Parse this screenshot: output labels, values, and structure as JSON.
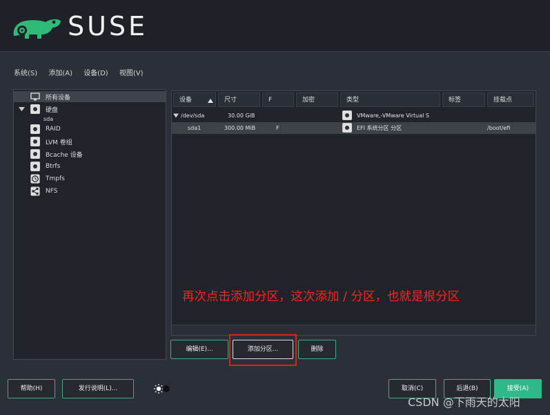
{
  "header": {
    "logo_text": "SUSE"
  },
  "menubar": [
    "系统(S)",
    "添加(A)",
    "设备(D)",
    "视图(V)"
  ],
  "tree": {
    "items": [
      {
        "label": "所有设备",
        "icon": "monitor-icon"
      },
      {
        "label": "硬盘",
        "icon": "harddisk-icon"
      },
      {
        "label": "sda",
        "icon": ""
      },
      {
        "label": "RAID",
        "icon": "raid-icon"
      },
      {
        "label": "LVM 卷组",
        "icon": "lvm-icon"
      },
      {
        "label": "Bcache 设备",
        "icon": "bcache-icon"
      },
      {
        "label": "Btrfs",
        "icon": "btrfs-icon"
      },
      {
        "label": "Tmpfs",
        "icon": "clock-icon"
      },
      {
        "label": "NFS",
        "icon": "share-icon"
      }
    ]
  },
  "table": {
    "columns": [
      "设备",
      "尺寸",
      "F",
      "加密",
      "类型",
      "标签",
      "挂载点"
    ],
    "rows": [
      {
        "device": "/dev/sda",
        "size": "30.00 GiB",
        "f": "",
        "enc": "",
        "type": "VMware,-VMware Virtual S",
        "label": "",
        "mount": ""
      },
      {
        "device": "sda1",
        "size": "300.00 MiB",
        "f": "F",
        "enc": "",
        "type": "EFI 系统分区 分区",
        "label": "",
        "mount": "/boot/efi"
      }
    ]
  },
  "annotation": "再次点击添加分区，这次添加 / 分区，也就是根分区",
  "buttons": {
    "edit": "编辑(E)...",
    "add_partition": "添加分区...",
    "delete": "删除",
    "help": "帮助(H)",
    "release_notes": "发行说明(L)...",
    "cancel": "取消(C)",
    "back": "后退(B)",
    "accept": "接受(A)"
  },
  "watermark": "CSDN @下雨天的太阳",
  "colors": {
    "accent": "#2fb98a",
    "annotation": "#ff2020",
    "background": "#2b3038"
  }
}
